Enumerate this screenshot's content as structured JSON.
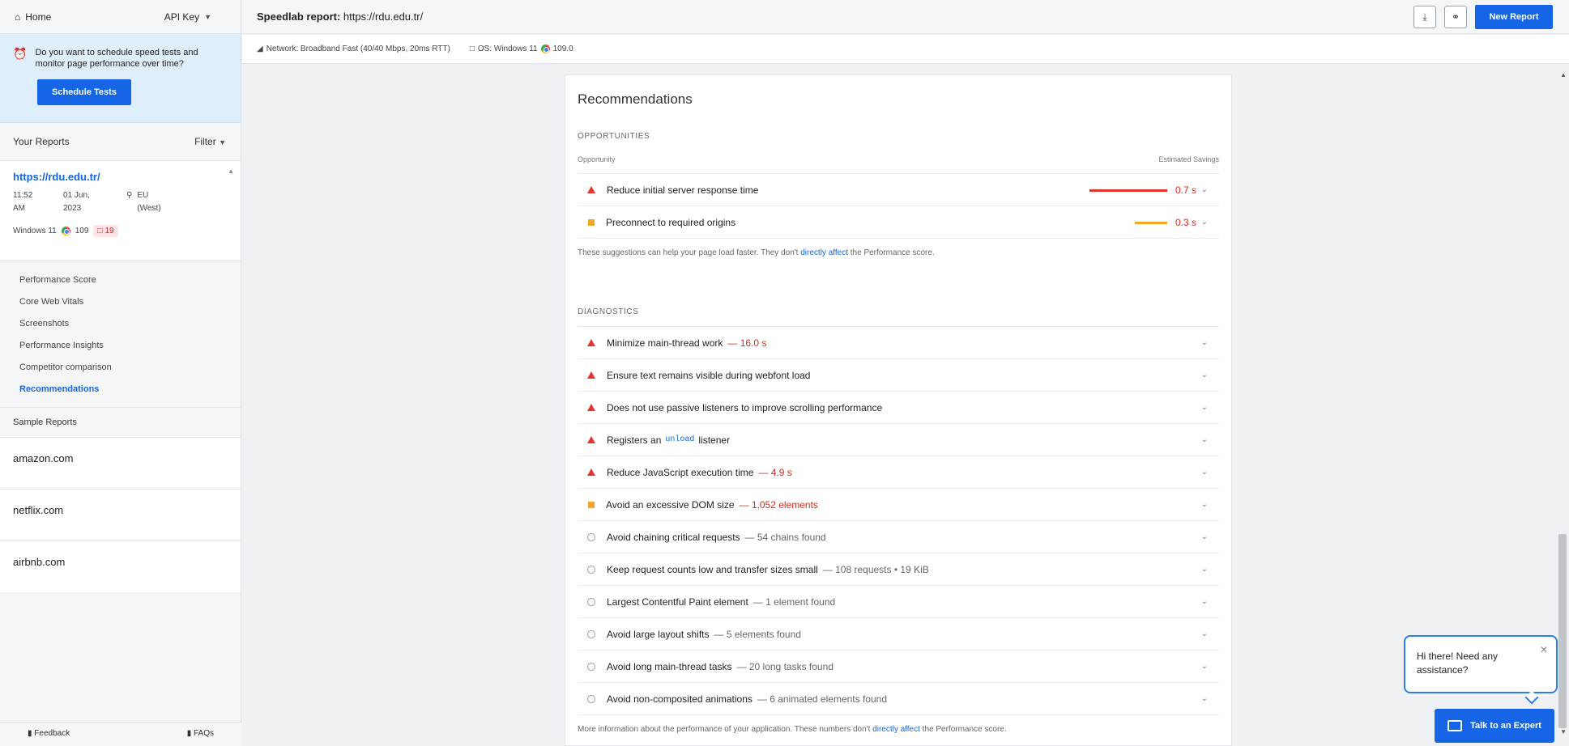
{
  "sidebar": {
    "home_label": "Home",
    "api_key_label": "API Key",
    "promo": {
      "text": "Do you want to schedule speed tests and monitor page performance over time?",
      "button": "Schedule Tests"
    },
    "your_reports_label": "Your Reports",
    "filter_label": "Filter",
    "report": {
      "url": "https://rdu.edu.tr/",
      "time": "11:52 AM",
      "date": "01 Jun, 2023",
      "location": "EU (West)",
      "os": "Windows 11",
      "browser_version": "109",
      "device_badge": "19"
    },
    "nav": [
      {
        "label": "Performance Score"
      },
      {
        "label": "Core Web Vitals"
      },
      {
        "label": "Screenshots"
      },
      {
        "label": "Performance Insights"
      },
      {
        "label": "Competitor comparison"
      },
      {
        "label": "Recommendations"
      }
    ],
    "sample_reports_label": "Sample Reports",
    "samples": [
      {
        "label": "amazon.com"
      },
      {
        "label": "netflix.com"
      },
      {
        "label": "airbnb.com"
      }
    ],
    "feedback_label": "Feedback",
    "faqs_label": "FAQs"
  },
  "topbar": {
    "title_prefix": "Speedlab report:",
    "title_url": "https://rdu.edu.tr/",
    "new_report": "New Report"
  },
  "infobar": {
    "network": "Network: Broadband Fast (40/40 Mbps, 20ms RTT)",
    "os": "OS: Windows 11",
    "browser_version": "109.0"
  },
  "main": {
    "title": "Recommendations",
    "opportunities_label": "OPPORTUNITIES",
    "opportunity_col": "Opportunity",
    "savings_col": "Estimated Savings",
    "opportunities": [
      {
        "label": "Reduce initial server response time",
        "saving": "0.7 s"
      },
      {
        "label": "Preconnect to required origins",
        "saving": "0.3 s"
      }
    ],
    "opp_note_pre": "These suggestions can help your page load faster. They don't",
    "opp_note_link": "directly affect",
    "opp_note_post": "the Performance score.",
    "diagnostics_label": "DIAGNOSTICS",
    "diagnostics": [
      {
        "label": "Minimize main-thread work",
        "detail": "— 16.0 s"
      },
      {
        "label": "Ensure text remains visible during webfont load",
        "detail": ""
      },
      {
        "label": "Does not use passive listeners to improve scrolling performance",
        "detail": ""
      },
      {
        "label_pre": "Registers an",
        "code": "unload",
        "label_post": "listener"
      },
      {
        "label": "Reduce JavaScript execution time",
        "detail": "— 4.9 s"
      },
      {
        "label": "Avoid an excessive DOM size",
        "detail": "— 1,052 elements"
      },
      {
        "label": "Avoid chaining critical requests",
        "detail": "— 54 chains found"
      },
      {
        "label": "Keep request counts low and transfer sizes small",
        "detail": "— 108 requests • 19 KiB"
      },
      {
        "label": "Largest Contentful Paint element",
        "detail": "— 1 element found"
      },
      {
        "label": "Avoid large layout shifts",
        "detail": "— 5 elements found"
      },
      {
        "label": "Avoid long main-thread tasks",
        "detail": "— 20 long tasks found"
      },
      {
        "label": "Avoid non-composited animations",
        "detail": "— 6 animated elements found"
      }
    ],
    "diag_note_pre": "More information about the performance of your application. These numbers don't",
    "diag_note_link": "directly affect",
    "diag_note_post": "the Performance score."
  },
  "chat": {
    "message": "Hi there! Need any assistance?",
    "button": "Talk to an Expert"
  }
}
